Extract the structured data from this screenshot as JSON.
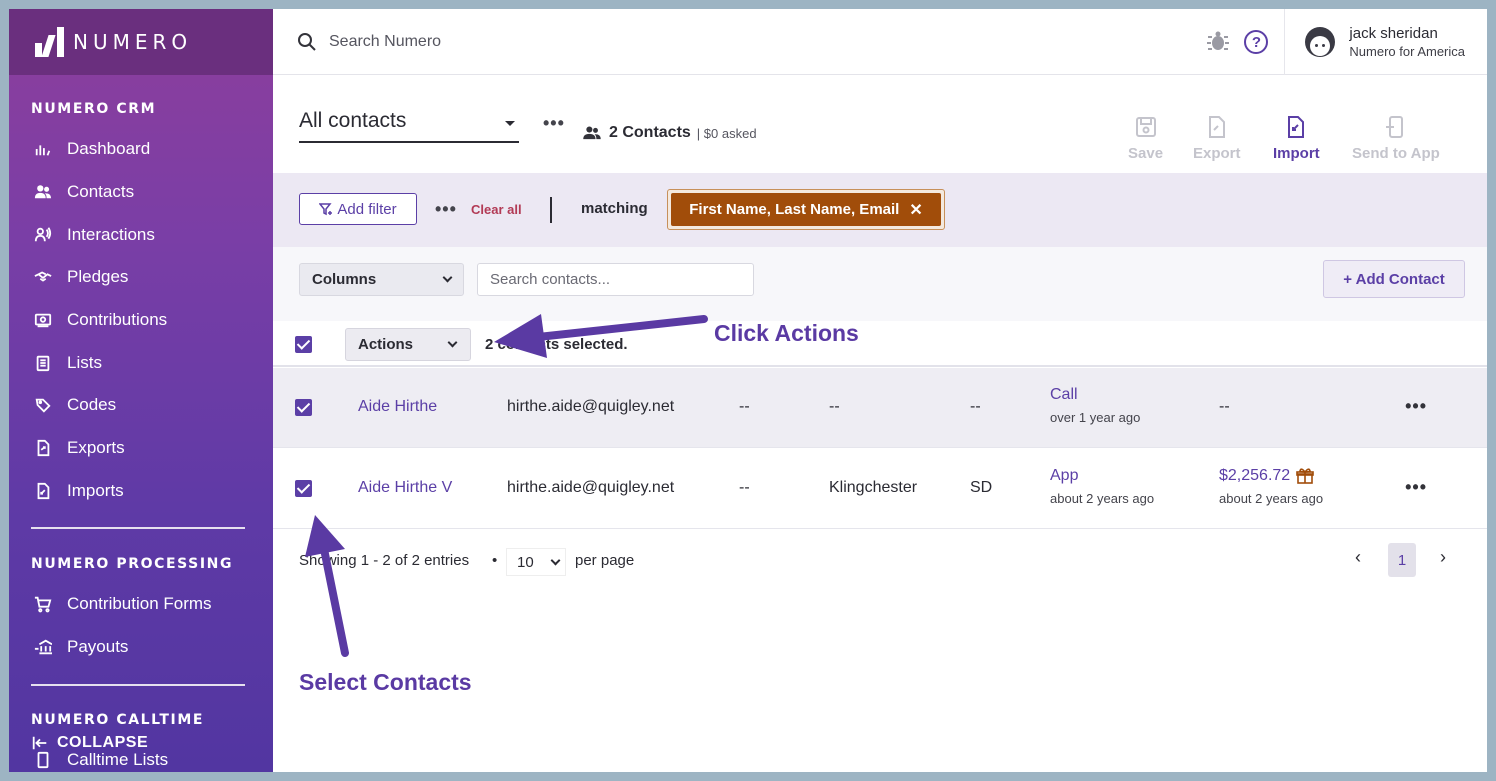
{
  "brand": {
    "logo_text": "NUMERO"
  },
  "sidebar": {
    "sections": [
      {
        "title": "NUMERO CRM"
      },
      {
        "title": "NUMERO PROCESSING"
      },
      {
        "title": "NUMERO CALLTIME"
      }
    ],
    "crm_items": [
      {
        "label": "Dashboard",
        "icon": "chart-hand-icon"
      },
      {
        "label": "Contacts",
        "icon": "people-icon"
      },
      {
        "label": "Interactions",
        "icon": "person-wave-icon"
      },
      {
        "label": "Pledges",
        "icon": "handshake-icon"
      },
      {
        "label": "Contributions",
        "icon": "money-icon"
      },
      {
        "label": "Lists",
        "icon": "clipboard-icon"
      },
      {
        "label": "Codes",
        "icon": "tag-icon"
      },
      {
        "label": "Exports",
        "icon": "file-export-icon"
      },
      {
        "label": "Imports",
        "icon": "file-import-icon"
      }
    ],
    "processing_items": [
      {
        "label": "Contribution Forms",
        "icon": "cart-icon"
      },
      {
        "label": "Payouts",
        "icon": "bank-icon"
      }
    ],
    "calltime_items": [
      {
        "label": "Calltime Lists",
        "icon": "phone-list-icon"
      }
    ],
    "collapse_label": "COLLAPSE"
  },
  "topbar": {
    "search_placeholder": "Search Numero",
    "help_glyph": "?",
    "user": {
      "name": "jack sheridan",
      "org": "Numero for America"
    }
  },
  "header": {
    "view": "All contacts",
    "contact_count": "2 Contacts",
    "asked": "| $0 asked",
    "tools": [
      {
        "label": "Save",
        "active": false
      },
      {
        "label": "Export",
        "active": false
      },
      {
        "label": "Import",
        "active": true
      },
      {
        "label": "Send to App",
        "active": false
      }
    ]
  },
  "filters": {
    "add_filter": "Add filter",
    "clear_all": "Clear all",
    "matching": "matching",
    "chip": "First Name, Last Name, Email",
    "chip_close": "✕"
  },
  "list": {
    "columns_label": "Columns",
    "search_placeholder": "Search contacts...",
    "add_contact": "+ Add Contact",
    "actions_label": "Actions",
    "selected_text": "2 contacts selected."
  },
  "rows": [
    {
      "name": "Aide Hirthe",
      "email": "hirthe.aide@quigley.net",
      "c3": "--",
      "city": "--",
      "state": "--",
      "last_interaction": "Call",
      "interaction_when": "over 1 year ago",
      "last_contribution": "--",
      "contribution_when": "",
      "checked": true
    },
    {
      "name": "Aide Hirthe V",
      "email": "hirthe.aide@quigley.net",
      "c3": "--",
      "city": "Klingchester",
      "state": "SD",
      "last_interaction": "App",
      "interaction_when": "about 2 years ago",
      "last_contribution": "$2,256.72",
      "contribution_when": "about 2 years ago",
      "checked": true
    }
  ],
  "pager": {
    "showing": "Showing 1 - 2 of 2 entries",
    "bullet": "•",
    "per_page_value": "10",
    "per_page_label": "per page",
    "prev": "‹",
    "page": "1",
    "next": "›"
  },
  "annotations": {
    "click_actions": "Click Actions",
    "select_contacts": "Select Contacts"
  },
  "colors": {
    "accent": "#5b3fa6",
    "chip": "#a14d0a",
    "annotation": "#5a3aa3"
  }
}
